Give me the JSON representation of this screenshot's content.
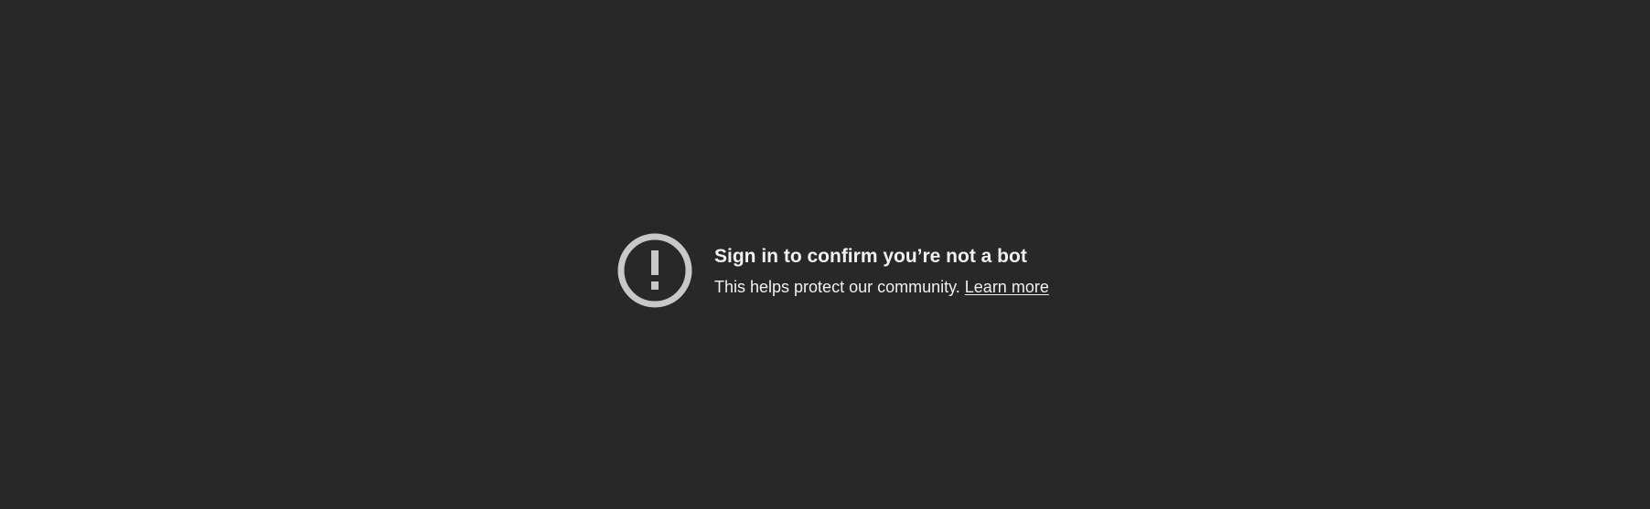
{
  "notice": {
    "title": "Sign in to confirm you’re not a bot",
    "body": "This helps protect our community. ",
    "link_label": "Learn more",
    "icon": "exclamation-circle-icon"
  },
  "colors": {
    "background": "#282828",
    "text": "#f1f1f1",
    "icon": "#c8c8c8"
  }
}
